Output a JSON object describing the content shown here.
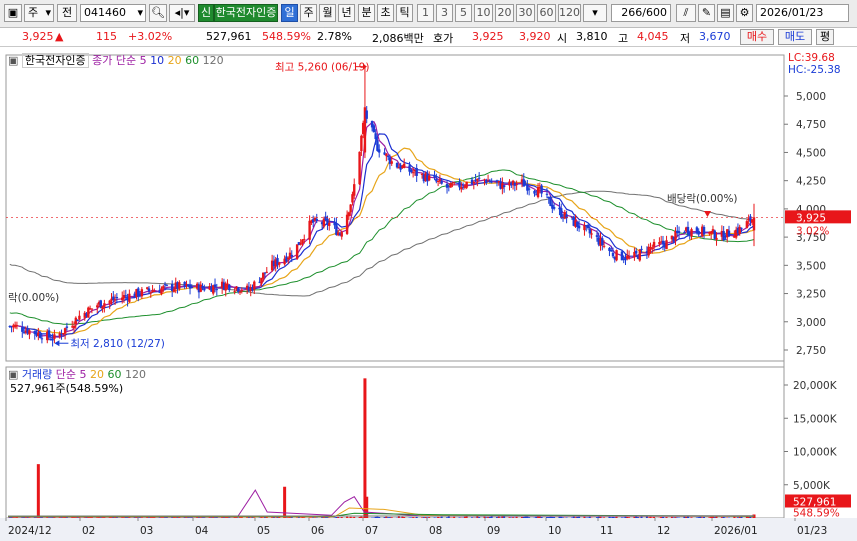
{
  "toolbar": {
    "market": "주",
    "period_type": "전",
    "code": "041460",
    "badge": "신",
    "name": "한국전자인증",
    "tabs": [
      "일",
      "주",
      "월",
      "년",
      "분",
      "초",
      "틱"
    ],
    "selected_tab": "일",
    "minute_options": [
      "1",
      "3",
      "5",
      "10",
      "20",
      "30",
      "60",
      "120"
    ],
    "count": "266",
    "count_total": "/600",
    "date": "2026/01/23"
  },
  "info": {
    "price": "3,925",
    "change": "115",
    "change_pct": "+3.02%",
    "volume": "527,961",
    "volume_ratio": "548.59%",
    "turnover": "2.78%",
    "amount": "2,086백만",
    "quote_label": "호가",
    "ask": "3,925",
    "bid": "3,920",
    "open_label": "시",
    "open": "3,810",
    "high_label": "고",
    "high": "4,045",
    "low_label": "저",
    "low": "3,670",
    "buy_label": "매수",
    "sell_label": "매도",
    "eval_label": "평"
  },
  "price_panel": {
    "stock_name": "한국전자인증",
    "ma_label": "종가 단순",
    "ma_periods": [
      "5",
      "10",
      "20",
      "60",
      "120"
    ],
    "lc": "LC:39.68",
    "hc": "HC:-25.38",
    "y_ticks": [
      "5,000",
      "4,750",
      "4,500",
      "4,250",
      "4,000",
      "3,750",
      "3,500",
      "3,250",
      "3,000",
      "2,750"
    ],
    "high_annotation": "최고 5,260 (06/19)",
    "low_annotation": "최저 2,810 (12/27)",
    "dividend_annotation": "배당락(0.00%)",
    "dividend_annotation_left": "락(0.00%)",
    "current_price_tag": "3,925",
    "current_pct_tag": "3.02%"
  },
  "volume_panel": {
    "title": "거래량",
    "ma_label": "단순",
    "ma_periods": [
      "5",
      "20",
      "60",
      "120"
    ],
    "current_volume": "527,961주(548.59%)",
    "y_ticks": [
      "20,000K",
      "15,000K",
      "10,000K",
      "5,000K"
    ],
    "current_tag": "527,961",
    "current_pct_tag": "548.59%"
  },
  "x_axis": {
    "labels": [
      "2024/12",
      "02",
      "03",
      "04",
      "05",
      "06",
      "07",
      "08",
      "09",
      "10",
      "11",
      "12",
      "2026/01",
      "01/23"
    ]
  },
  "colors": {
    "up": "#e8161a",
    "down": "#1a3cd6",
    "ma5": "#9d1fa3",
    "ma10": "#1b2fd1",
    "ma20": "#e7a51a",
    "ma60": "#1d8f2c",
    "ma120": "#707070",
    "selected": "#2f6fd6"
  },
  "chart_data": {
    "type": "candlestick",
    "title": "한국전자인증",
    "x_range": [
      "2024/12",
      "2026/01/23"
    ],
    "price_ylim": [
      2700,
      5250
    ],
    "price_close_series": [
      [
        "2024/12/05",
        2960
      ],
      [
        "2024/12/27",
        2850
      ],
      [
        "2025/01/10",
        3050
      ],
      [
        "2025/01/20",
        3150
      ],
      [
        "2025/02/03",
        3220
      ],
      [
        "2025/02/20",
        3280
      ],
      [
        "2025/03/05",
        3310
      ],
      [
        "2025/03/20",
        3300
      ],
      [
        "2025/04/03",
        3330
      ],
      [
        "2025/04/15",
        3280
      ],
      [
        "2025/04/28",
        3500
      ],
      [
        "2025/05/10",
        3620
      ],
      [
        "2025/05/20",
        3880
      ],
      [
        "2025/05/30",
        3870
      ],
      [
        "2025/06/05",
        3780
      ],
      [
        "2025/06/12",
        4100
      ],
      [
        "2025/06/19",
        4850
      ],
      [
        "2025/06/26",
        4550
      ],
      [
        "2025/07/05",
        4400
      ],
      [
        "2025/07/15",
        4330
      ],
      [
        "2025/07/25",
        4270
      ],
      [
        "2025/08/05",
        4180
      ],
      [
        "2025/08/15",
        4230
      ],
      [
        "2025/08/25",
        4260
      ],
      [
        "2025/09/05",
        4200
      ],
      [
        "2025/09/15",
        4230
      ],
      [
        "2025/09/25",
        4150
      ],
      [
        "2025/10/05",
        3980
      ],
      [
        "2025/10/15",
        3870
      ],
      [
        "2025/10/25",
        3760
      ],
      [
        "2025/11/05",
        3600
      ],
      [
        "2025/11/15",
        3560
      ],
      [
        "2025/11/25",
        3650
      ],
      [
        "2025/12/05",
        3700
      ],
      [
        "2025/12/15",
        3820
      ],
      [
        "2025/12/25",
        3800
      ],
      [
        "2026/01/05",
        3760
      ],
      [
        "2026/01/15",
        3820
      ],
      [
        "2026/01/23",
        3925
      ]
    ],
    "high": {
      "value": 5260,
      "date": "06/19"
    },
    "low": {
      "value": 2810,
      "date": "12/27"
    },
    "last": {
      "close": 3925,
      "open": 3810,
      "high": 4045,
      "low": 3670,
      "change": 115,
      "change_pct": 3.02
    },
    "volume_ylim": [
      0,
      21000000
    ],
    "volume_spikes": [
      [
        "2024/12/18",
        8100000
      ],
      [
        "2025/05/05",
        4700000
      ],
      [
        "2025/06/19",
        21000000
      ],
      [
        "2025/06/20",
        3200000
      ],
      [
        "2026/01/23",
        527961
      ]
    ]
  }
}
